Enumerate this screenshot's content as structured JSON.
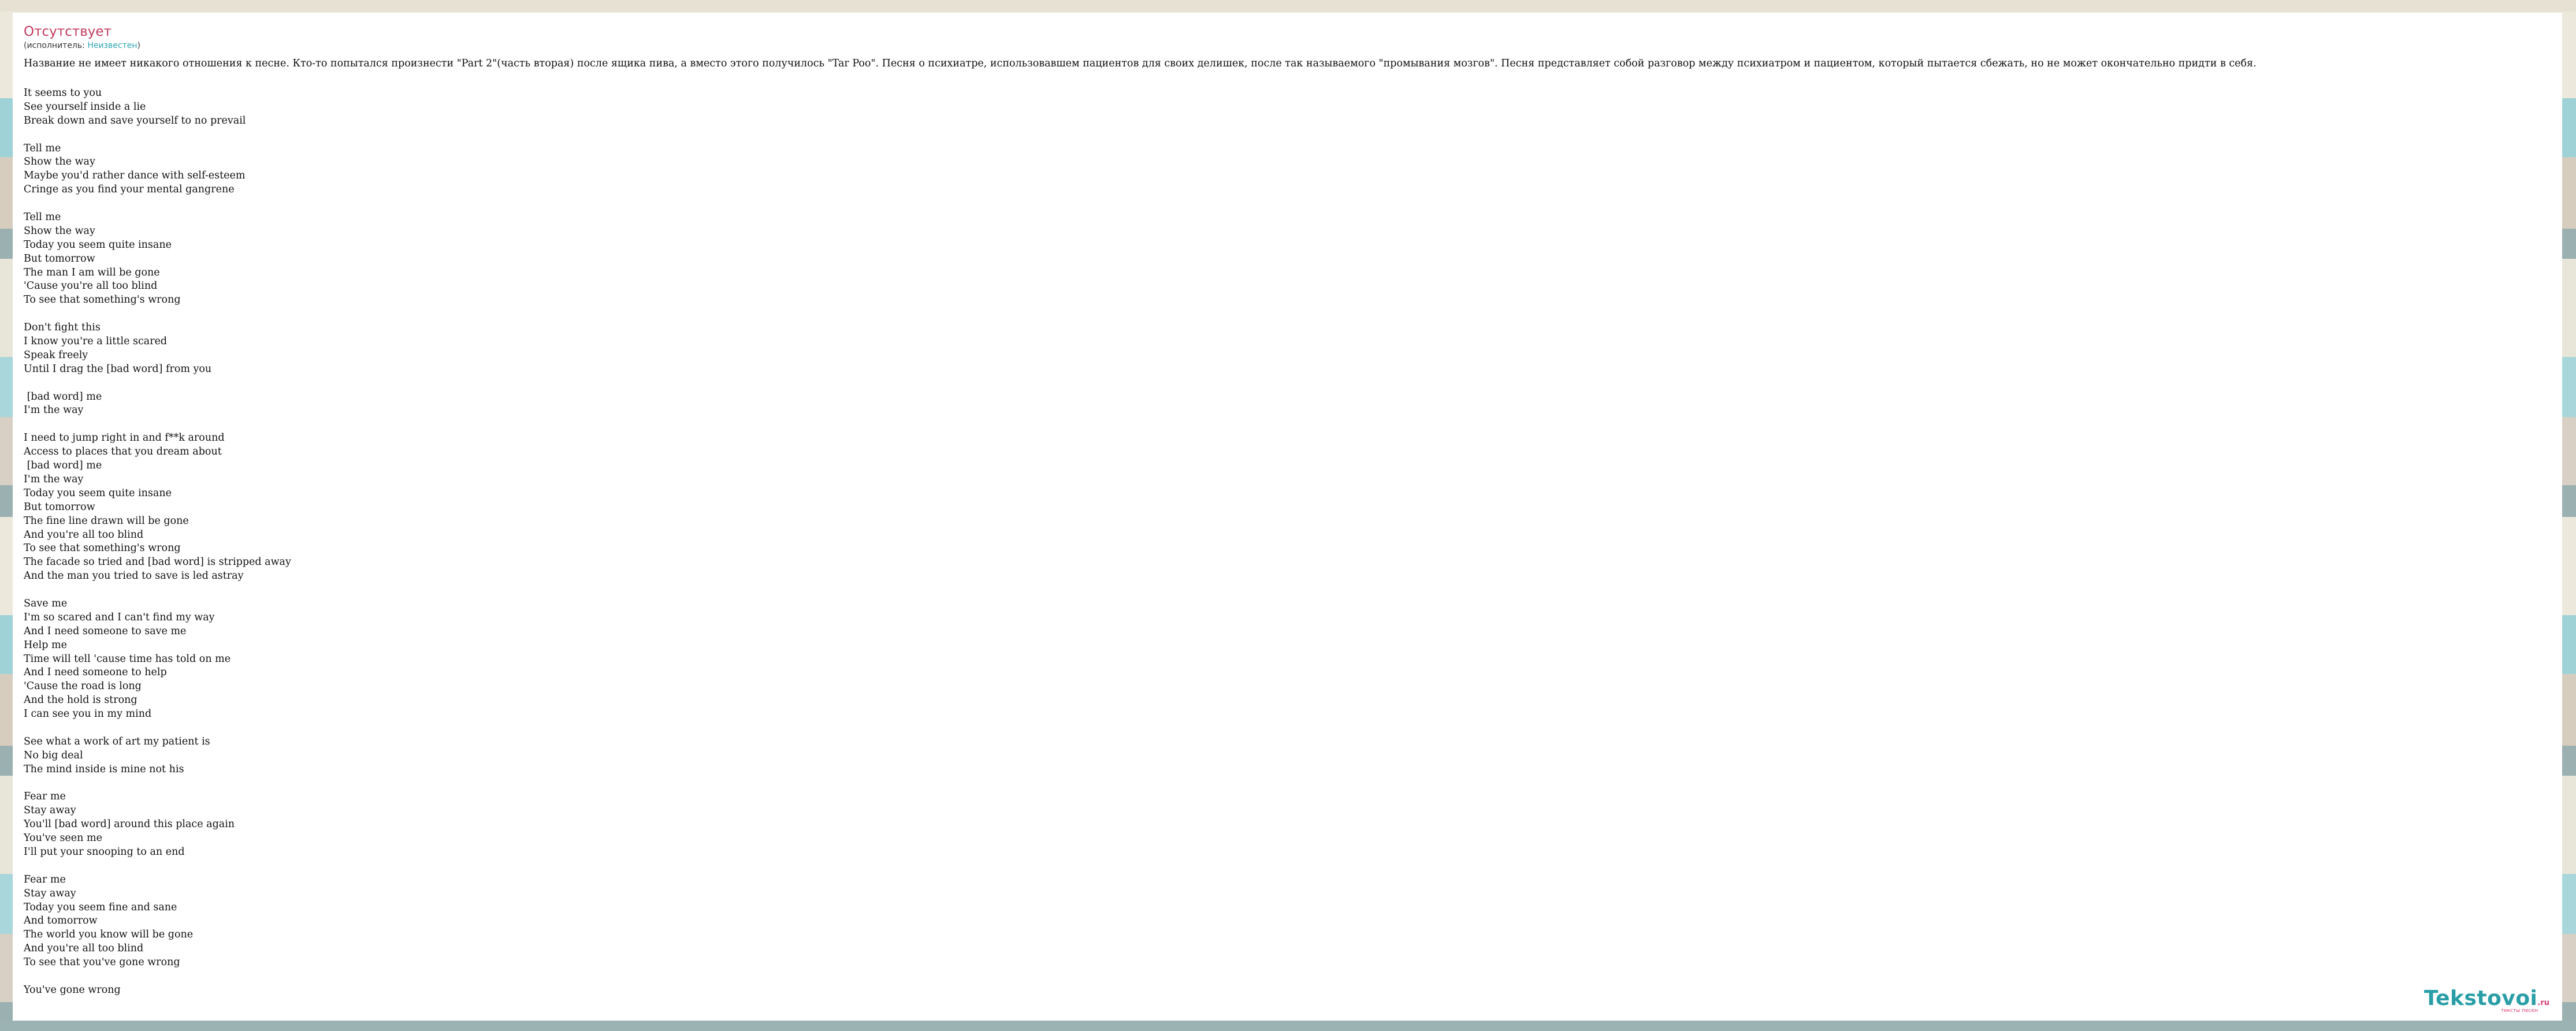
{
  "song": {
    "title": "Отсутствует",
    "artist_prefix": "(исполнитель: ",
    "artist_name": "Неизвестен",
    "artist_suffix": ")"
  },
  "description": "Название не имеет никакого отношения к песне. Кто-то попытался произнести \"Part 2\"(часть вторая) после ящика пива, а вместо этого получилось \"Tar Poo\". Песня о психиатре, использовавшем пациентов для своих делишек, после так называемого \"промывания мозгов\". Песня представляет собой разговор между психиатром и пациентом, который пытается сбежать, но не может окончательно придти в себя.",
  "lyrics": [
    "It seems to you",
    "See yourself inside a lie",
    "Break down and save yourself to no prevail",
    "",
    "Tell me",
    "Show the way",
    "Maybe you'd rather dance with self-esteem",
    "Cringe as you find your mental gangrene",
    "",
    "Tell me",
    "Show the way",
    "Today you seem quite insane",
    "But tomorrow",
    "The man I am will be gone",
    "'Cause you're all too blind",
    "To see that something's wrong",
    "",
    "Don't fight this",
    "I know you're a little scared",
    "Speak freely",
    "Until I drag the [bad word] from you",
    "",
    " [bad word] me",
    "I'm the way",
    "",
    "I need to jump right in and f**k around",
    "Access to places that you dream about",
    " [bad word] me",
    "I'm the way",
    "Today you seem quite insane",
    "But tomorrow",
    "The fine line drawn will be gone",
    "And you're all too blind",
    "To see that something's wrong",
    "The facade so tried and [bad word] is stripped away",
    "And the man you tried to save is led astray",
    "",
    "Save me",
    "I'm so scared and I can't find my way",
    "And I need someone to save me",
    "Help me",
    "Time will tell 'cause time has told on me",
    "And I need someone to help",
    "'Cause the road is long",
    "And the hold is strong",
    "I can see you in my mind",
    "",
    "See what a work of art my patient is",
    "No big deal",
    "The mind inside is mine not his",
    "",
    "Fear me",
    "Stay away",
    "You'll [bad word] around this place again",
    "You've seen me",
    "I'll put your snooping to an end",
    "",
    "Fear me",
    "Stay away",
    "Today you seem fine and sane",
    "And tomorrow",
    "The world you know will be gone",
    "And you're all too blind",
    "To see that you've gone wrong",
    "",
    "You've gone wrong"
  ],
  "logo": {
    "main": "Tekstovoi",
    "tld": ".ru",
    "tagline": "тексты песен"
  },
  "colors": {
    "title": "#c23b5f",
    "link": "#2da6b1",
    "logo": "#2a9ea6",
    "logo_accent": "#d83b72"
  }
}
